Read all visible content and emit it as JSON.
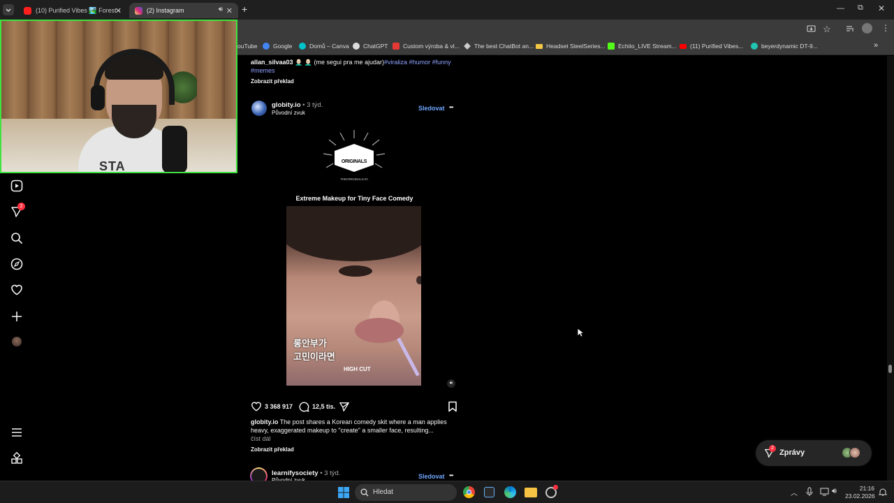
{
  "browser": {
    "tabs": [
      {
        "label": "(10) Purified Vibes 🏞️ Forest -",
        "favicon_color": "#ff1f1f"
      },
      {
        "label": "(2) Instagram",
        "favicon_color": "#d62976"
      }
    ],
    "new_tab": "+",
    "bookmarks": [
      {
        "label": "ouTube",
        "color": "#ff0000"
      },
      {
        "label": "Google",
        "color": "#4285f4"
      },
      {
        "label": "Domů – Canva",
        "color": "#00c4cc"
      },
      {
        "label": "ChatGPT",
        "color": "#dddddd"
      },
      {
        "label": "Custom výroba & vl...",
        "color": "#e53935"
      },
      {
        "label": "The best ChatBot an...",
        "color": "#cccccc"
      },
      {
        "label": "Headset SteelSeries...",
        "color": "#f2c744"
      },
      {
        "label": "Echito_LIVE Stream...",
        "color": "#53fc18"
      },
      {
        "label": "(11) Purified Vibes...",
        "color": "#ff0000"
      },
      {
        "label": "beyerdynamic DT-9...",
        "color": "#20c4b0"
      }
    ]
  },
  "feed": {
    "prev_post": {
      "username": "allan_silvaa03",
      "caption": "👨🏻‍🦲 👨🏻‍🦲 (me segui pra me ajudar)",
      "hashtags_line1": "#viraliza #humor #funny",
      "hashtags_line2": "#memes",
      "translate": "Zobrazit překlad"
    },
    "post": {
      "username": "globity.io",
      "age": "• 3 týd.",
      "audio": "Původní zvuk",
      "follow": "Sledovat",
      "more": "•••",
      "reel_brand_top": "ORIGINALS",
      "reel_brand_url": "THEORIGINALS.IO",
      "reel_title": "Extreme Makeup for Tiny Face Comedy",
      "reel_korean_line1": "롱안부가",
      "reel_korean_line2": "고민이라면",
      "reel_small_caption": "HIGH CUT",
      "likes": "3 368 917",
      "comments": "12,5 tis.",
      "caption_user": "globity.io",
      "caption_line1": "The post shares a Korean comedy skit where a man applies",
      "caption_line2": "heavy, exaggerated makeup to \"create\" a smaller face, resulting...",
      "read_more": "číst dál",
      "translate": "Zobrazit překlad"
    },
    "next_post": {
      "username": "learnifysociety",
      "age": "• 3 týd.",
      "audio": "Původní zvuk",
      "follow": "Sledovat",
      "more": "•••"
    }
  },
  "sidebar": {
    "notification_badge": "2"
  },
  "messages": {
    "label": "Zprávy",
    "badge": "2"
  },
  "taskbar": {
    "search_label": "Hledat",
    "time": "21:16",
    "date": "23.02.2026"
  },
  "colors": {
    "accent_link": "#6fa8ff",
    "hashtag": "#8ea2ff",
    "badge": "#ff3040",
    "webcam_border": "#3fe23f"
  }
}
